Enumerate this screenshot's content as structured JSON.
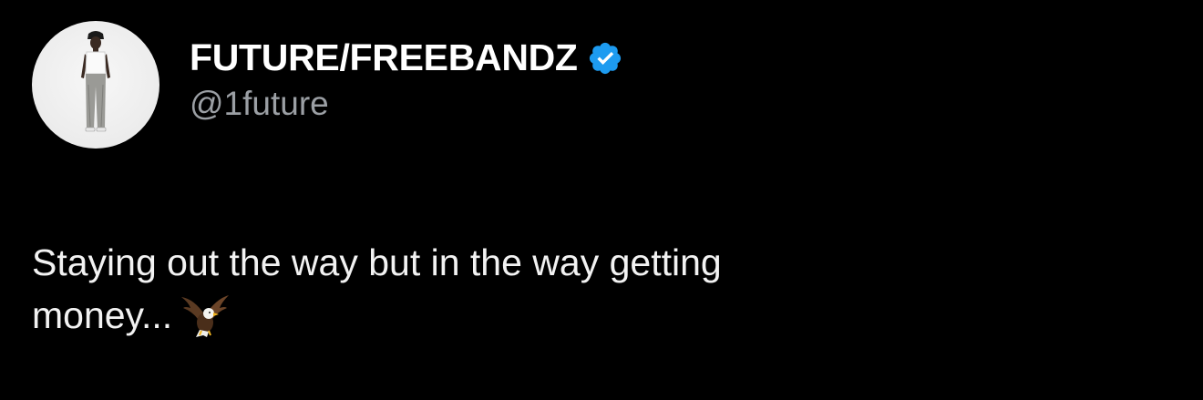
{
  "tweet": {
    "display_name": "FUTURE/FREEBANDZ",
    "handle": "@1future",
    "text_line1": "Staying out the way but in the way getting",
    "text_line2": "money...",
    "verified_color": "#1d9bf0"
  },
  "icons": {
    "verified": "verified-badge-icon",
    "emoji": "eagle-emoji"
  }
}
